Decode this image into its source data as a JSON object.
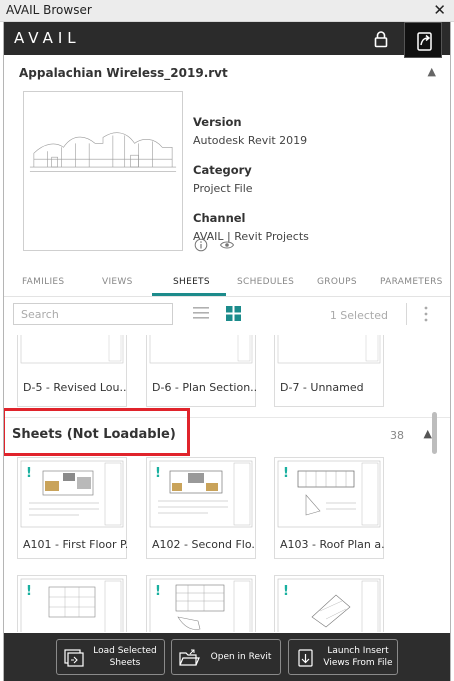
{
  "window": {
    "title": "AVAIL Browser",
    "close_glyph": "✕"
  },
  "app": {
    "logo": "AVAIL"
  },
  "file": {
    "name": "Appalachian Wireless_2019.rvt",
    "version_label": "Version",
    "version_value": "Autodesk Revit 2019",
    "category_label": "Category",
    "category_value": "Project File",
    "channel_label": "Channel",
    "channel_value": "AVAIL | Revit Projects"
  },
  "tabs": [
    {
      "label": "FAMILIES",
      "active": false
    },
    {
      "label": "VIEWS",
      "active": false
    },
    {
      "label": "SHEETS",
      "active": true
    },
    {
      "label": "SCHEDULES",
      "active": false
    },
    {
      "label": "GROUPS",
      "active": false
    },
    {
      "label": "PARAMETERS",
      "active": false
    }
  ],
  "toolbar": {
    "search_placeholder": "Search",
    "selected_count": "1 Selected"
  },
  "loadable_sheets": [
    {
      "label": "D-5 - Revised Lou..."
    },
    {
      "label": "D-6 - Plan Section..."
    },
    {
      "label": "D-7 - Unnamed"
    }
  ],
  "section": {
    "title": "Sheets (Not Loadable)",
    "count": "38"
  },
  "not_loadable_sheets": [
    {
      "label": "A101 - First Floor P...",
      "flag": "!"
    },
    {
      "label": "A102 - Second Flo...",
      "flag": "!"
    },
    {
      "label": "A103 - Roof Plan a...",
      "flag": "!"
    },
    {
      "label": "",
      "flag": "!"
    },
    {
      "label": "",
      "flag": "!"
    },
    {
      "label": "",
      "flag": "!"
    }
  ],
  "footer": {
    "load_selected": "Load Selected Sheets",
    "open_in_revit": "Open in Revit",
    "launch_insert": "Launch Insert Views From File"
  },
  "colors": {
    "accent": "#1c8b8b",
    "warning": "#1ab0a0",
    "highlight": "#e0232b",
    "appbar": "#2b2b2b"
  },
  "icons": [
    "close-icon",
    "lock-icon",
    "share-icon",
    "chevron-up-icon",
    "info-icon",
    "eye-icon",
    "list-view-icon",
    "grid-view-icon",
    "kebab-icon",
    "load-sheets-icon",
    "folder-open-icon",
    "insert-views-icon"
  ]
}
